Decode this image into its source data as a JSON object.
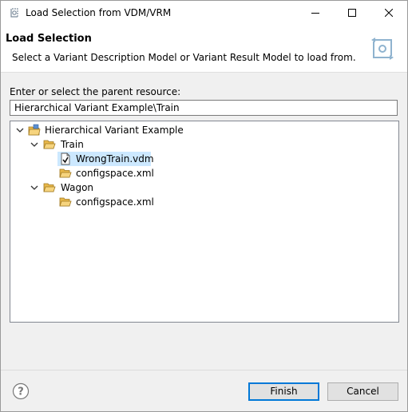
{
  "window": {
    "title": "Load Selection from VDM/VRM"
  },
  "header": {
    "title": "Load Selection",
    "description": "Select a Variant Description Model or Variant Result Model to load from."
  },
  "form": {
    "label": "Enter or select the parent resource:",
    "value": "Hierarchical Variant Example\\Train"
  },
  "tree": {
    "nodes": [
      {
        "label": "Hierarchical Variant Example",
        "icon": "project-folder-icon",
        "expanded": true
      },
      {
        "label": "Train",
        "icon": "open-folder-icon",
        "expanded": true
      },
      {
        "label": "WrongTrain.vdm",
        "icon": "vdm-file-icon",
        "selected": true
      },
      {
        "label": "configspace.xml",
        "icon": "open-folder-icon"
      },
      {
        "label": "Wagon",
        "icon": "open-folder-icon",
        "expanded": true
      },
      {
        "label": "configspace.xml",
        "icon": "open-folder-icon"
      }
    ],
    "selection_color": "#cce8ff"
  },
  "buttons": {
    "finish": "Finish",
    "cancel": "Cancel",
    "help": "?"
  },
  "colors": {
    "accent": "#0078d7",
    "dialog_bg": "#f0f0f0",
    "folder": "#e8b84a"
  }
}
